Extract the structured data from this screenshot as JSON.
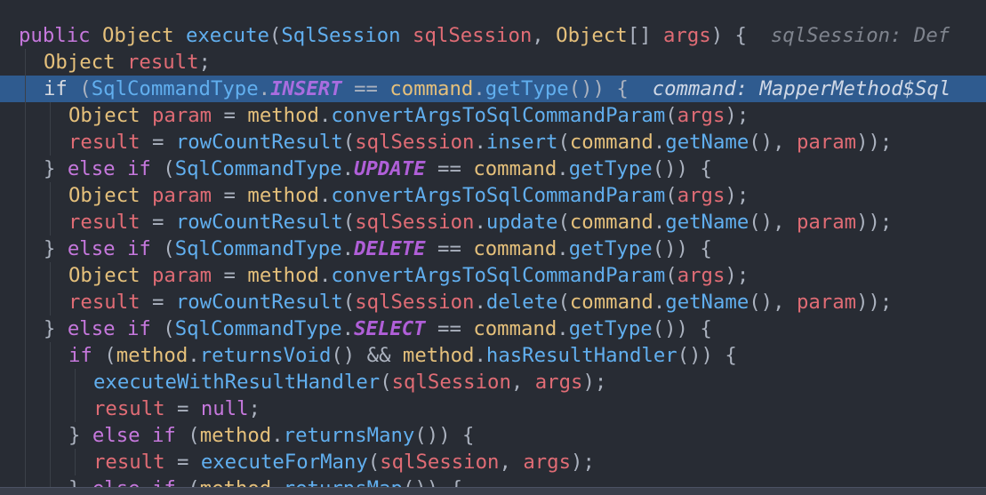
{
  "editor": {
    "lines": [
      {
        "indent": 0,
        "active": false,
        "tokens": [
          {
            "t": "public ",
            "c": "k"
          },
          {
            "t": "Object",
            "c": "t"
          },
          {
            "t": " ",
            "c": "p"
          },
          {
            "t": "execute",
            "c": "f"
          },
          {
            "t": "(",
            "c": "p"
          },
          {
            "t": "SqlSession",
            "c": "ty"
          },
          {
            "t": " ",
            "c": "p"
          },
          {
            "t": "sqlSession",
            "c": "v"
          },
          {
            "t": ", ",
            "c": "p"
          },
          {
            "t": "Object",
            "c": "t"
          },
          {
            "t": "[] ",
            "c": "p"
          },
          {
            "t": "args",
            "c": "v"
          },
          {
            "t": ") {  ",
            "c": "p"
          },
          {
            "t": "sqlSession: Def",
            "c": "hint"
          }
        ]
      },
      {
        "indent": 1,
        "active": false,
        "tokens": [
          {
            "t": "Object",
            "c": "t"
          },
          {
            "t": " ",
            "c": "p"
          },
          {
            "t": "result",
            "c": "v"
          },
          {
            "t": ";",
            "c": "p"
          }
        ]
      },
      {
        "indent": 1,
        "active": true,
        "tokens": [
          {
            "t": "if",
            "c": "k"
          },
          {
            "t": " (",
            "c": "p"
          },
          {
            "t": "SqlCommandType",
            "c": "ty"
          },
          {
            "t": ".",
            "c": "p"
          },
          {
            "t": "INSERT",
            "c": "cn"
          },
          {
            "t": " == ",
            "c": "p"
          },
          {
            "t": "command",
            "c": "t"
          },
          {
            "t": ".",
            "c": "p"
          },
          {
            "t": "getType",
            "c": "f"
          },
          {
            "t": "()) {  ",
            "c": "p"
          },
          {
            "t": "command: MapperMethod$Sql",
            "c": "hint"
          }
        ]
      },
      {
        "indent": 2,
        "active": false,
        "tokens": [
          {
            "t": "Object",
            "c": "t"
          },
          {
            "t": " ",
            "c": "p"
          },
          {
            "t": "param",
            "c": "v"
          },
          {
            "t": " = ",
            "c": "p"
          },
          {
            "t": "method",
            "c": "t"
          },
          {
            "t": ".",
            "c": "p"
          },
          {
            "t": "convertArgsToSqlCommandParam",
            "c": "f"
          },
          {
            "t": "(",
            "c": "p"
          },
          {
            "t": "args",
            "c": "v"
          },
          {
            "t": ");",
            "c": "p"
          }
        ]
      },
      {
        "indent": 2,
        "active": false,
        "tokens": [
          {
            "t": "result",
            "c": "v"
          },
          {
            "t": " = ",
            "c": "p"
          },
          {
            "t": "rowCountResult",
            "c": "f"
          },
          {
            "t": "(",
            "c": "p"
          },
          {
            "t": "sqlSession",
            "c": "v"
          },
          {
            "t": ".",
            "c": "p"
          },
          {
            "t": "insert",
            "c": "f"
          },
          {
            "t": "(",
            "c": "p"
          },
          {
            "t": "command",
            "c": "t"
          },
          {
            "t": ".",
            "c": "p"
          },
          {
            "t": "getName",
            "c": "f"
          },
          {
            "t": "(), ",
            "c": "p"
          },
          {
            "t": "param",
            "c": "v"
          },
          {
            "t": "));",
            "c": "p"
          }
        ]
      },
      {
        "indent": 1,
        "active": false,
        "tokens": [
          {
            "t": "} ",
            "c": "p"
          },
          {
            "t": "else if",
            "c": "k"
          },
          {
            "t": " (",
            "c": "p"
          },
          {
            "t": "SqlCommandType",
            "c": "ty"
          },
          {
            "t": ".",
            "c": "p"
          },
          {
            "t": "UPDATE",
            "c": "cn"
          },
          {
            "t": " == ",
            "c": "p"
          },
          {
            "t": "command",
            "c": "t"
          },
          {
            "t": ".",
            "c": "p"
          },
          {
            "t": "getType",
            "c": "f"
          },
          {
            "t": "()) {",
            "c": "p"
          }
        ]
      },
      {
        "indent": 2,
        "active": false,
        "tokens": [
          {
            "t": "Object",
            "c": "t"
          },
          {
            "t": " ",
            "c": "p"
          },
          {
            "t": "param",
            "c": "v"
          },
          {
            "t": " = ",
            "c": "p"
          },
          {
            "t": "method",
            "c": "t"
          },
          {
            "t": ".",
            "c": "p"
          },
          {
            "t": "convertArgsToSqlCommandParam",
            "c": "f"
          },
          {
            "t": "(",
            "c": "p"
          },
          {
            "t": "args",
            "c": "v"
          },
          {
            "t": ");",
            "c": "p"
          }
        ]
      },
      {
        "indent": 2,
        "active": false,
        "tokens": [
          {
            "t": "result",
            "c": "v"
          },
          {
            "t": " = ",
            "c": "p"
          },
          {
            "t": "rowCountResult",
            "c": "f"
          },
          {
            "t": "(",
            "c": "p"
          },
          {
            "t": "sqlSession",
            "c": "v"
          },
          {
            "t": ".",
            "c": "p"
          },
          {
            "t": "update",
            "c": "f"
          },
          {
            "t": "(",
            "c": "p"
          },
          {
            "t": "command",
            "c": "t"
          },
          {
            "t": ".",
            "c": "p"
          },
          {
            "t": "getName",
            "c": "f"
          },
          {
            "t": "(), ",
            "c": "p"
          },
          {
            "t": "param",
            "c": "v"
          },
          {
            "t": "));",
            "c": "p"
          }
        ]
      },
      {
        "indent": 1,
        "active": false,
        "tokens": [
          {
            "t": "} ",
            "c": "p"
          },
          {
            "t": "else if",
            "c": "k"
          },
          {
            "t": " (",
            "c": "p"
          },
          {
            "t": "SqlCommandType",
            "c": "ty"
          },
          {
            "t": ".",
            "c": "p"
          },
          {
            "t": "DELETE",
            "c": "cn"
          },
          {
            "t": " == ",
            "c": "p"
          },
          {
            "t": "command",
            "c": "t"
          },
          {
            "t": ".",
            "c": "p"
          },
          {
            "t": "getType",
            "c": "f"
          },
          {
            "t": "()) {",
            "c": "p"
          }
        ]
      },
      {
        "indent": 2,
        "active": false,
        "tokens": [
          {
            "t": "Object",
            "c": "t"
          },
          {
            "t": " ",
            "c": "p"
          },
          {
            "t": "param",
            "c": "v"
          },
          {
            "t": " = ",
            "c": "p"
          },
          {
            "t": "method",
            "c": "t"
          },
          {
            "t": ".",
            "c": "p"
          },
          {
            "t": "convertArgsToSqlCommandParam",
            "c": "f"
          },
          {
            "t": "(",
            "c": "p"
          },
          {
            "t": "args",
            "c": "v"
          },
          {
            "t": ");",
            "c": "p"
          }
        ]
      },
      {
        "indent": 2,
        "active": false,
        "tokens": [
          {
            "t": "result",
            "c": "v"
          },
          {
            "t": " = ",
            "c": "p"
          },
          {
            "t": "rowCountResult",
            "c": "f"
          },
          {
            "t": "(",
            "c": "p"
          },
          {
            "t": "sqlSession",
            "c": "v"
          },
          {
            "t": ".",
            "c": "p"
          },
          {
            "t": "delete",
            "c": "f"
          },
          {
            "t": "(",
            "c": "p"
          },
          {
            "t": "command",
            "c": "t"
          },
          {
            "t": ".",
            "c": "p"
          },
          {
            "t": "getName",
            "c": "f"
          },
          {
            "t": "(), ",
            "c": "p"
          },
          {
            "t": "param",
            "c": "v"
          },
          {
            "t": "));",
            "c": "p"
          }
        ]
      },
      {
        "indent": 1,
        "active": false,
        "tokens": [
          {
            "t": "} ",
            "c": "p"
          },
          {
            "t": "else if",
            "c": "k"
          },
          {
            "t": " (",
            "c": "p"
          },
          {
            "t": "SqlCommandType",
            "c": "ty"
          },
          {
            "t": ".",
            "c": "p"
          },
          {
            "t": "SELECT",
            "c": "cn"
          },
          {
            "t": " == ",
            "c": "p"
          },
          {
            "t": "command",
            "c": "t"
          },
          {
            "t": ".",
            "c": "p"
          },
          {
            "t": "getType",
            "c": "f"
          },
          {
            "t": "()) {",
            "c": "p"
          }
        ]
      },
      {
        "indent": 2,
        "active": false,
        "tokens": [
          {
            "t": "if",
            "c": "k"
          },
          {
            "t": " (",
            "c": "p"
          },
          {
            "t": "method",
            "c": "t"
          },
          {
            "t": ".",
            "c": "p"
          },
          {
            "t": "returnsVoid",
            "c": "f"
          },
          {
            "t": "() && ",
            "c": "p"
          },
          {
            "t": "method",
            "c": "t"
          },
          {
            "t": ".",
            "c": "p"
          },
          {
            "t": "hasResultHandler",
            "c": "f"
          },
          {
            "t": "()) {",
            "c": "p"
          }
        ]
      },
      {
        "indent": 3,
        "active": false,
        "tokens": [
          {
            "t": "executeWithResultHandler",
            "c": "f"
          },
          {
            "t": "(",
            "c": "p"
          },
          {
            "t": "sqlSession",
            "c": "v"
          },
          {
            "t": ", ",
            "c": "p"
          },
          {
            "t": "args",
            "c": "v"
          },
          {
            "t": ");",
            "c": "p"
          }
        ]
      },
      {
        "indent": 3,
        "active": false,
        "tokens": [
          {
            "t": "result",
            "c": "v"
          },
          {
            "t": " = ",
            "c": "p"
          },
          {
            "t": "null",
            "c": "k"
          },
          {
            "t": ";",
            "c": "p"
          }
        ]
      },
      {
        "indent": 2,
        "active": false,
        "tokens": [
          {
            "t": "} ",
            "c": "p"
          },
          {
            "t": "else if",
            "c": "k"
          },
          {
            "t": " (",
            "c": "p"
          },
          {
            "t": "method",
            "c": "t"
          },
          {
            "t": ".",
            "c": "p"
          },
          {
            "t": "returnsMany",
            "c": "f"
          },
          {
            "t": "()) {",
            "c": "p"
          }
        ]
      },
      {
        "indent": 3,
        "active": false,
        "tokens": [
          {
            "t": "result",
            "c": "v"
          },
          {
            "t": " = ",
            "c": "p"
          },
          {
            "t": "executeForMany",
            "c": "f"
          },
          {
            "t": "(",
            "c": "p"
          },
          {
            "t": "sqlSession",
            "c": "v"
          },
          {
            "t": ", ",
            "c": "p"
          },
          {
            "t": "args",
            "c": "v"
          },
          {
            "t": ");",
            "c": "p"
          }
        ]
      },
      {
        "indent": 2,
        "active": false,
        "tokens": [
          {
            "t": "} ",
            "c": "p"
          },
          {
            "t": "else if",
            "c": "k"
          },
          {
            "t": " (",
            "c": "p"
          },
          {
            "t": "method",
            "c": "t"
          },
          {
            "t": ".",
            "c": "p"
          },
          {
            "t": "returnsMap",
            "c": "f"
          },
          {
            "t": "()) {",
            "c": "p"
          }
        ]
      }
    ]
  },
  "colors": {
    "background": "#282c34",
    "active_line": "#2f5b8f",
    "keyword": "#c678dd",
    "type": "#e5c07b",
    "function": "#61afef",
    "variable": "#e06c75",
    "constant": "#b05fd8",
    "hint": "#7f848e"
  }
}
